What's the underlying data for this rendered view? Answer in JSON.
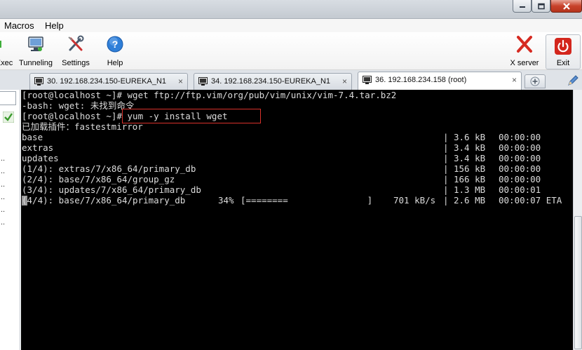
{
  "menu": {
    "items": [
      "Macros",
      "Help"
    ]
  },
  "toolbar": {
    "buttons": [
      {
        "label": "Exec",
        "icon": "exec-icon"
      },
      {
        "label": "Tunneling",
        "icon": "monitor-icon"
      },
      {
        "label": "Settings",
        "icon": "settings-tools-icon"
      },
      {
        "label": "Help",
        "icon": "help-icon"
      },
      {
        "label": "X server",
        "icon": "x-server-icon"
      },
      {
        "label": "Exit",
        "icon": "power-icon"
      }
    ]
  },
  "tabs": [
    {
      "label": "30. 192.168.234.150-EUREKA_N1",
      "close": "×",
      "active": false
    },
    {
      "label": "34. 192.168.234.150-EUREKA_N1",
      "close": "×",
      "active": false
    },
    {
      "label": "36. 192.168.234.158 (root)",
      "close": "×",
      "active": true
    }
  ],
  "terminal": {
    "lines": [
      "[root@localhost ~]# wget ftp://ftp.vim/org/pub/vim/unix/vim-7.4.tar.bz2",
      "-bash: wget: 未找到命令",
      "[root@localhost ~]# yum -y install wget",
      "已加载插件：fastestmirror"
    ],
    "rows": [
      {
        "name": "base",
        "size": "3.6 kB",
        "time": "00:00:00"
      },
      {
        "name": "extras",
        "size": "3.4 kB",
        "time": "00:00:00"
      },
      {
        "name": "updates",
        "size": "3.4 kB",
        "time": "00:00:00"
      },
      {
        "name": "(1/4): extras/7/x86_64/primary_db",
        "size": "156 kB",
        "time": "00:00:00"
      },
      {
        "name": "(2/4): base/7/x86_64/group_gz",
        "size": "166 kB",
        "time": "00:00:00"
      },
      {
        "name": "(3/4): updates/7/x86_64/primary_db",
        "size": "1.3 MB",
        "time": "00:00:01"
      }
    ],
    "progress_line": {
      "name": "(4/4): base/7/x86_64/primary_db",
      "percent": "34%",
      "bar": "[========               ]",
      "speed": "701 kB/s",
      "size": "2.6 MB",
      "time": "00:00:07 ETA"
    },
    "separator": "|"
  },
  "colors": {
    "terminal_bg": "#000000",
    "terminal_fg": "#dcdcdc",
    "highlight_border": "#d9322b"
  }
}
